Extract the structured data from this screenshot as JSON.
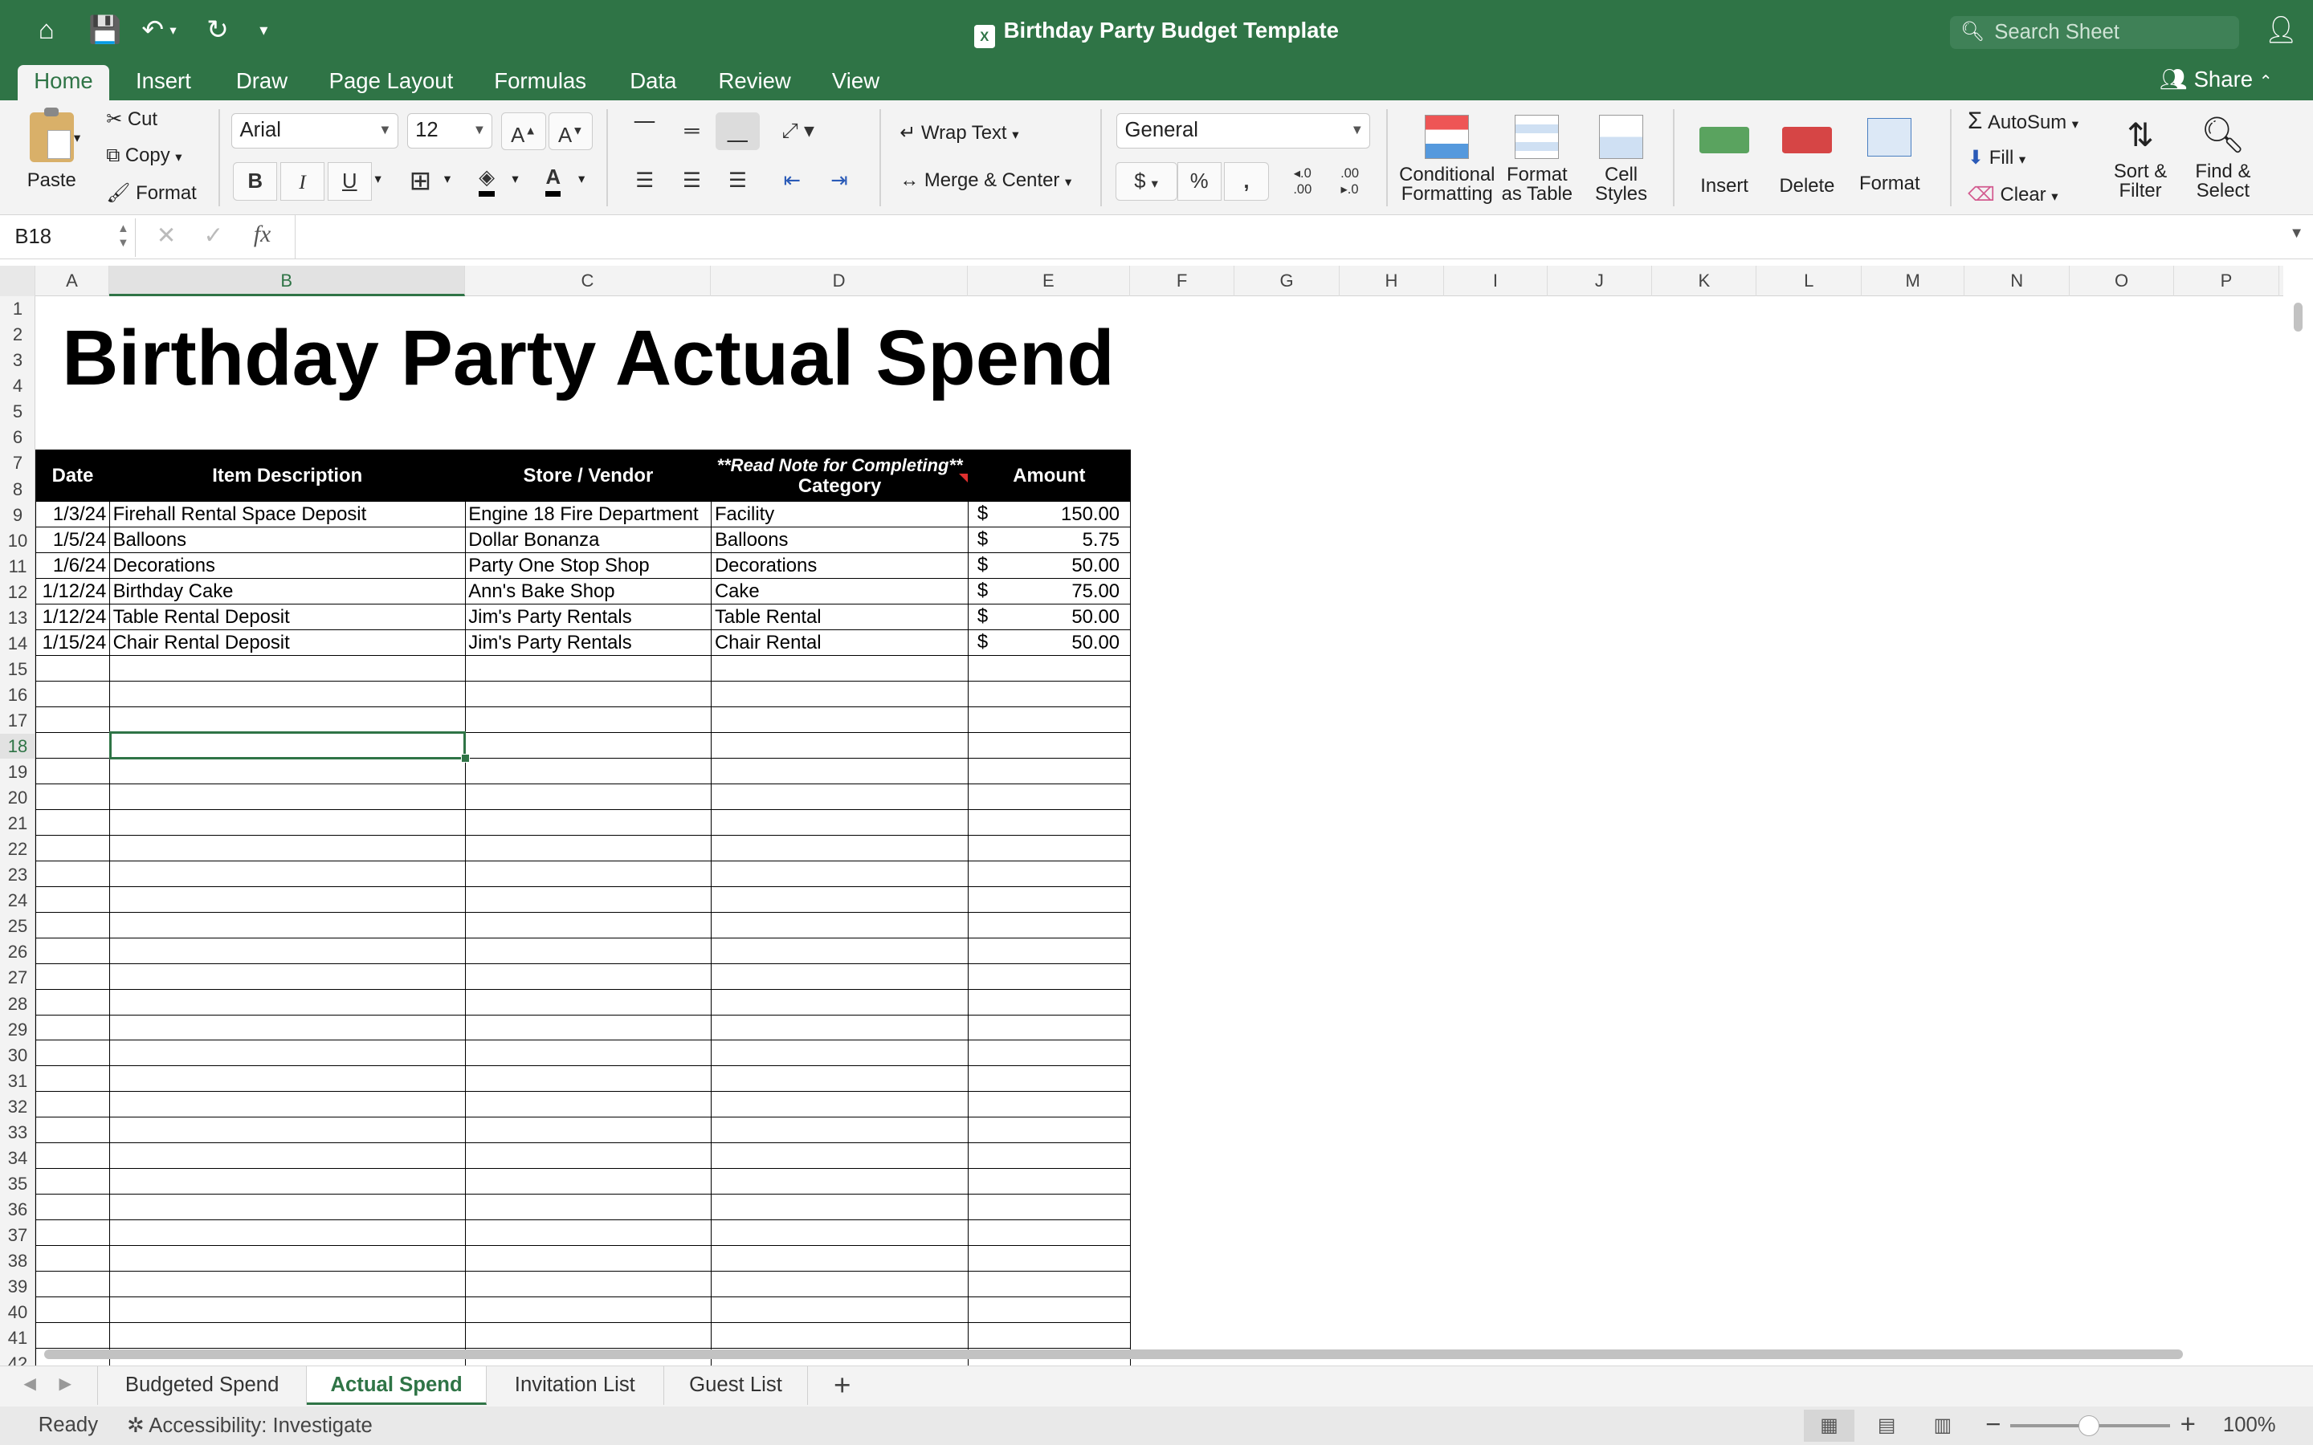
{
  "window": {
    "title": "Birthday Party Budget Template",
    "search_placeholder": "Search Sheet",
    "share_label": "Share"
  },
  "menu": [
    "Home",
    "Insert",
    "Draw",
    "Page Layout",
    "Formulas",
    "Data",
    "Review",
    "View"
  ],
  "ribbon": {
    "paste": "Paste",
    "cut": "Cut",
    "copy": "Copy",
    "format_painter": "Format",
    "font_name": "Arial",
    "font_size": "12",
    "bold": "B",
    "italic": "I",
    "underline": "U",
    "wrap_text": "Wrap Text",
    "merge_center": "Merge & Center",
    "number_format": "General",
    "currency": "$",
    "percent": "%",
    "comma": ",",
    "conditional_formatting": [
      "Conditional",
      "Formatting"
    ],
    "format_as_table": [
      "Format",
      "as Table"
    ],
    "cell_styles": [
      "Cell",
      "Styles"
    ],
    "insert": "Insert",
    "delete": "Delete",
    "format": "Format",
    "autosum": "AutoSum",
    "fill": "Fill",
    "clear": "Clear",
    "sort_filter": [
      "Sort &",
      "Filter"
    ],
    "find_select": [
      "Find &",
      "Select"
    ]
  },
  "formula_bar": {
    "name_box": "B18",
    "fx": "fx",
    "formula": ""
  },
  "columns": [
    "A",
    "B",
    "C",
    "D",
    "E",
    "F",
    "G",
    "H",
    "I",
    "J",
    "K",
    "L",
    "M",
    "N",
    "O",
    "P"
  ],
  "selected_column": "B",
  "selected_row": "18",
  "rows_visible": [
    "1",
    "2",
    "3",
    "4",
    "5",
    "6",
    "7",
    "8",
    "9",
    "10",
    "11",
    "12",
    "13",
    "14",
    "15",
    "16",
    "17",
    "18",
    "19",
    "20",
    "21",
    "22",
    "23",
    "24",
    "25",
    "26",
    "27",
    "28",
    "29",
    "30",
    "31",
    "32",
    "33",
    "34",
    "35",
    "36",
    "37",
    "38",
    "39",
    "40",
    "41",
    "42"
  ],
  "sheet": {
    "title": "Birthday Party Actual Spend",
    "headers": {
      "date": "Date",
      "description": "Item Description",
      "vendor": "Store / Vendor",
      "category_note": "**Read Note for Completing**",
      "category": "Category",
      "amount": "Amount"
    },
    "currency_symbol": "$",
    "rows": [
      {
        "date": "1/3/24",
        "description": "Firehall Rental Space Deposit",
        "vendor": "Engine 18 Fire Department",
        "category": "Facility",
        "amount": "150.00"
      },
      {
        "date": "1/5/24",
        "description": "Balloons",
        "vendor": "Dollar Bonanza",
        "category": "Balloons",
        "amount": "5.75"
      },
      {
        "date": "1/6/24",
        "description": "Decorations",
        "vendor": "Party One Stop Shop",
        "category": "Decorations",
        "amount": "50.00"
      },
      {
        "date": "1/12/24",
        "description": "Birthday Cake",
        "vendor": "Ann's Bake Shop",
        "category": "Cake",
        "amount": "75.00"
      },
      {
        "date": "1/12/24",
        "description": "Table Rental Deposit",
        "vendor": "Jim's Party Rentals",
        "category": "Table Rental",
        "amount": "50.00"
      },
      {
        "date": "1/15/24",
        "description": "Chair Rental Deposit",
        "vendor": "Jim's Party Rentals",
        "category": "Chair Rental",
        "amount": "50.00"
      }
    ]
  },
  "sheet_tabs": [
    "Budgeted Spend",
    "Actual Spend",
    "Invitation List",
    "Guest List"
  ],
  "active_tab": "Actual Spend",
  "status": {
    "ready": "Ready",
    "accessibility": "Accessibility: Investigate",
    "zoom": "100%"
  },
  "colors": {
    "accent": "#2f7446",
    "header_fill": "#000000"
  }
}
